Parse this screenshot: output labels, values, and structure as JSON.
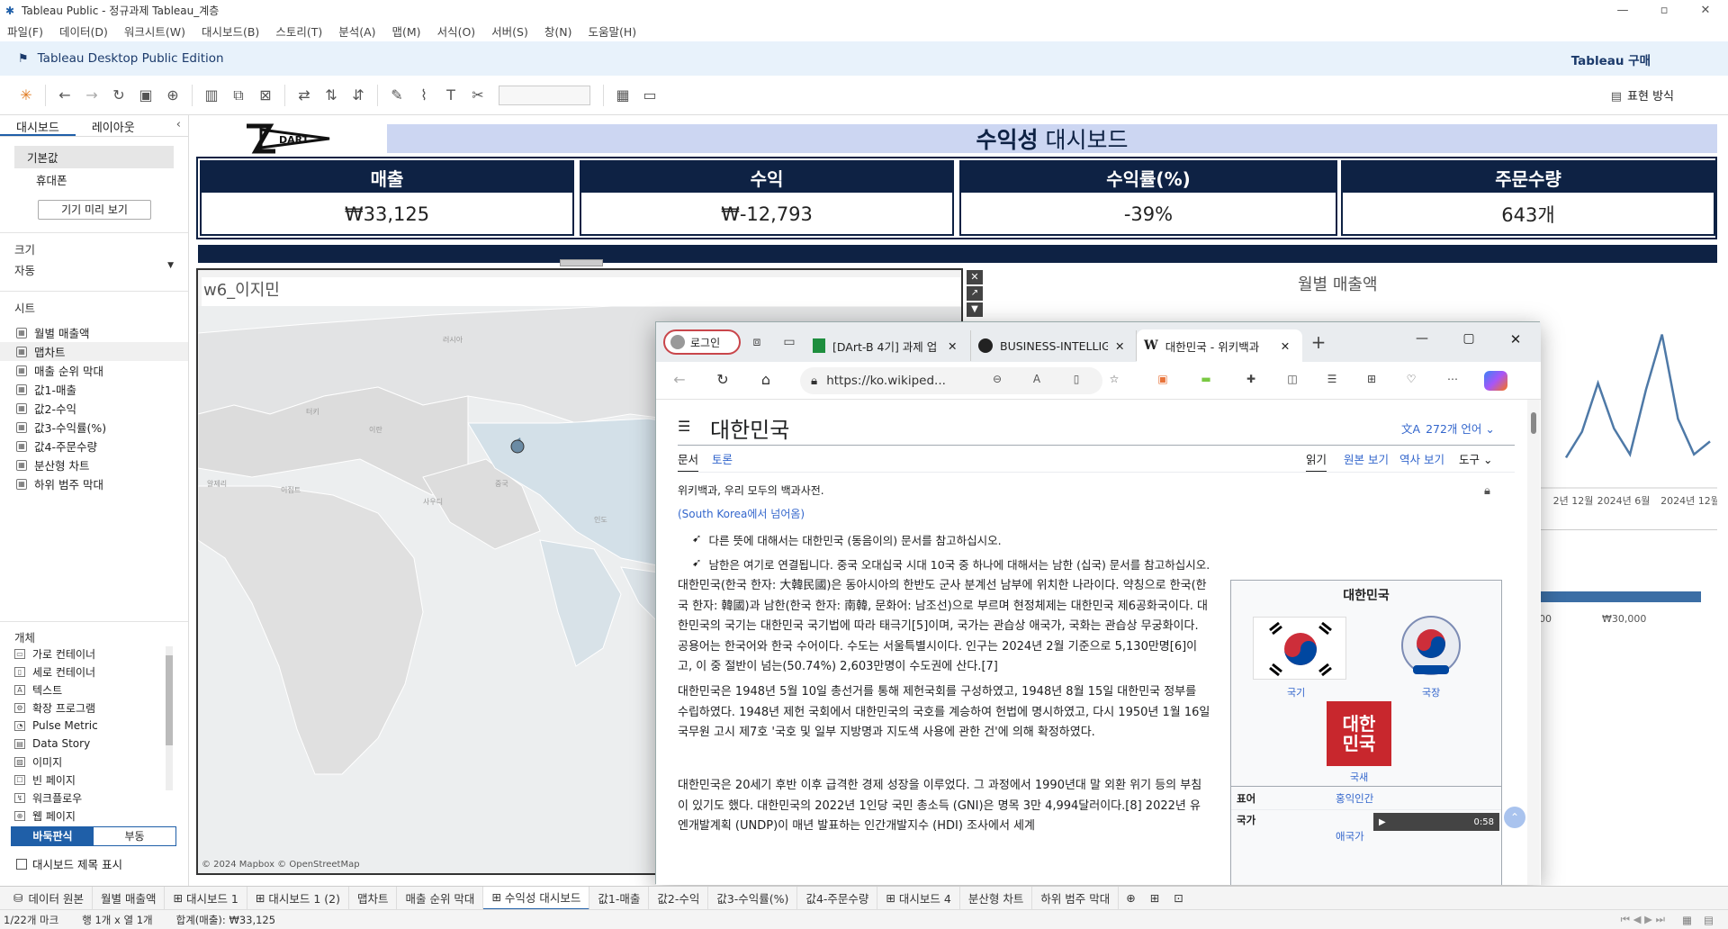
{
  "window": {
    "title": "Tableau Public - 정규과제 Tableau_계층"
  },
  "menu": [
    "파일(F)",
    "데이터(D)",
    "워크시트(W)",
    "대시보드(B)",
    "스토리(T)",
    "분석(A)",
    "맵(M)",
    "서식(O)",
    "서버(S)",
    "창(N)",
    "도움말(H)"
  ],
  "edition": {
    "label": "Tableau Desktop Public Edition",
    "buy": "Tableau 구매"
  },
  "toolbar": {
    "show_me": "표현 방식"
  },
  "left": {
    "tabs": [
      "대시보드",
      "레이아웃"
    ],
    "devices": [
      "기본값",
      "휴대폰"
    ],
    "preview_button": "기기 미리 보기",
    "size_label": "크기",
    "size_value": "자동",
    "sheets_label": "시트",
    "sheets": [
      "월별 매출액",
      "맵차트",
      "매출 순위 막대",
      "값1-매출",
      "값2-수익",
      "값3-수익률(%)",
      "값4-주문수량",
      "분산형 차트",
      "하위 범주 막대"
    ],
    "objects_label": "개체",
    "objects": [
      "가로 컨테이너",
      "세로 컨테이너",
      "텍스트",
      "확장 프로그램",
      "Pulse Metric",
      "Data Story",
      "이미지",
      "빈 페이지",
      "워크플로우",
      "웹 페이지"
    ],
    "tiled": "바둑판식",
    "floating": "부동",
    "show_title": "대시보드 제목 표시"
  },
  "dashboard": {
    "logo": "DART",
    "title_bold": "수익성",
    "title_rest": " 대시보드",
    "kpis": [
      {
        "label": "매출",
        "value": "₩33,125"
      },
      {
        "label": "수익",
        "value": "₩-12,793"
      },
      {
        "label": "수익률(%)",
        "value": "-39%"
      },
      {
        "label": "주문수량",
        "value": "643개"
      }
    ],
    "map_title": "w6_이지민",
    "map_credit": "© 2024 Mapbox © OpenStreetMap",
    "map_labels": [
      "러시아",
      "이란",
      "터키",
      "알제리",
      "이집트",
      "중국",
      "사우디",
      "인도"
    ],
    "line_title": "월별 매출액",
    "line_ticks": [
      "2년 12월",
      "2024년 6월",
      "2024년 12월"
    ],
    "line_values": [
      12,
      28,
      58,
      30,
      14,
      54,
      88,
      36,
      14,
      22
    ],
    "bar_ticks": [
      "00",
      "₩30,000"
    ]
  },
  "browser": {
    "login": "로그인",
    "tabs": [
      "[DArt-B 4기] 과제 업",
      "BUSINESS-INTELLIG",
      "대한민국 - 위키백과"
    ],
    "url": "https://ko.wikiped...",
    "wiki": {
      "title": "대한민국",
      "lang": "272개 언어",
      "tab_doc": "문서",
      "tab_talk": "토론",
      "read": "읽기",
      "source": "원본 보기",
      "history": "역사 보기",
      "tools": "도구",
      "tagline": "위키백과, 우리 모두의 백과사전.",
      "redirect": "(South Korea에서 넘어옴)",
      "hat1": "다른 뜻에 대해서는 대한민국 (동음이의) 문서를 참고하십시오.",
      "hat2": "남한은 여기로 연결됩니다. 중국 오대십국 시대 10국 중 하나에 대해서는 남한 (십국) 문서를 참고하십시오.",
      "p1": "대한민국(한국 한자: 大韓民國)은 동아시아의 한반도 군사 분계선 남부에 위치한 나라이다. 약칭으로 한국(한국 한자: 韓國)과 남한(한국 한자: 南韓, 문화어: 남조선)으로 부르며 현정체제는 대한민국 제6공화국이다. 대한민국의 국기는 대한민국 국기법에 따라 태극기[5]이며, 국가는 관습상 애국가, 국화는 관습상 무궁화이다. 공용어는 한국어와 한국 수어이다. 수도는 서울특별시이다. 인구는 2024년 2월 기준으로 5,130만명[6]이고, 이 중 절반이 넘는(50.74%) 2,603만명이 수도권에 산다.[7]",
      "p2": "대한민국은 1948년 5월 10일 총선거를 통해 제헌국회를 구성하였고, 1948년 8월 15일 대한민국 정부를 수립하였다. 1948년 제헌 국회에서 대한민국의 국호를 계승하여 헌법에 명시하였고, 다시 1950년 1월 16일 국무원 고시 제7호 '국호 및 일부 지방명과 지도색 사용에 관한 건'에 의해 확정하였다.",
      "p3": "대한민국은 20세기 후반 이후 급격한 경제 성장을 이루었다. 그 과정에서 1990년대 말 외환 위기 등의 부침이 있기도 했다. 대한민국의 2022년 1인당 국민 총소득 (GNI)은 명목 3만 4,994달러이다.[8] 2022년 유엔개발계획 (UNDP)이 매년 발표하는 인간개발지수 (HDI) 조사에서 세계",
      "infobox": {
        "title": "대한민국",
        "flag": "국기",
        "emblem": "국장",
        "seal": "국새",
        "seal_text": "대한민국",
        "motto_label": "표어",
        "motto": "홍익인간",
        "anthem_label": "국가",
        "anthem": "애국가",
        "time": "0:58"
      }
    }
  },
  "sheet_tabs": [
    "데이터 원본",
    "월별 매출액",
    "대시보드 1",
    "대시보드 1 (2)",
    "맵차트",
    "매출 순위 막대",
    "수익성 대시보드",
    "값1-매출",
    "값2-수익",
    "값3-수익률(%)",
    "값4-주문수량",
    "대시보드 4",
    "분산형 차트",
    "하위 범주 막대"
  ],
  "status": {
    "marks": "1/22개 마크",
    "rows": "행 1개 x 열 1개",
    "sum": "합계(매출): ₩33,125"
  }
}
